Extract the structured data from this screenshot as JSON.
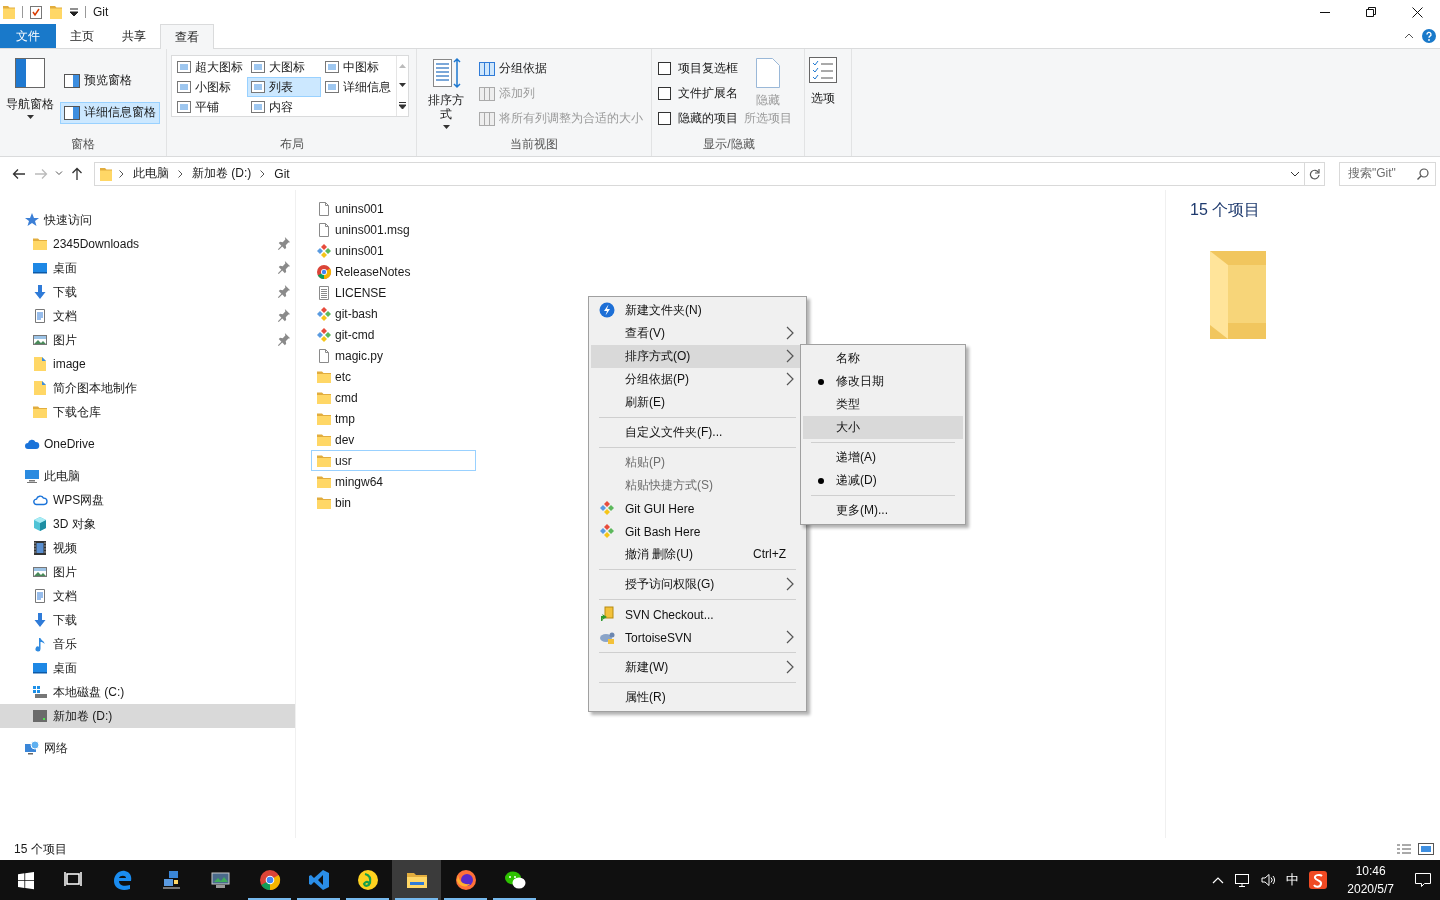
{
  "title_bar": {
    "title": "Git"
  },
  "ribbon": {
    "tabs": [
      {
        "label": "文件",
        "kind": "file-menu",
        "selected": false
      },
      {
        "label": "主页",
        "kind": "tab",
        "selected": false
      },
      {
        "label": "共享",
        "kind": "tab",
        "selected": false
      },
      {
        "label": "查看",
        "kind": "tab",
        "selected": true
      }
    ],
    "panes": {
      "label": "窗格",
      "nav_pane": "导航窗格",
      "preview_pane": {
        "label": "预览窗格",
        "selected": false
      },
      "details_pane": {
        "label": "详细信息窗格",
        "selected": true
      }
    },
    "layout": {
      "label": "布局",
      "options": [
        {
          "label": "超大图标",
          "selected": false
        },
        {
          "label": "大图标",
          "selected": false
        },
        {
          "label": "中图标",
          "selected": false
        },
        {
          "label": "小图标",
          "selected": false
        },
        {
          "label": "列表",
          "selected": true
        },
        {
          "label": "详细信息",
          "selected": false
        },
        {
          "label": "平铺",
          "selected": false
        },
        {
          "label": "内容",
          "selected": false
        }
      ]
    },
    "current_view": {
      "label": "当前视图",
      "sort_by": "排序方式",
      "commands": [
        {
          "label": "分组依据",
          "disabled": false
        },
        {
          "label": "添加列",
          "disabled": true
        },
        {
          "label": "将所有列调整为合适的大小",
          "disabled": true
        }
      ]
    },
    "show_hide": {
      "label": "显示/隐藏",
      "checkboxes": [
        {
          "label": "项目复选框",
          "checked": false
        },
        {
          "label": "文件扩展名",
          "checked": false
        },
        {
          "label": "隐藏的项目",
          "checked": false
        }
      ],
      "hide_selected": {
        "lines": [
          "隐藏",
          "所选项目"
        ],
        "disabled": true
      }
    },
    "options": {
      "label": "选项"
    }
  },
  "address_bar": {
    "path": [
      "此电脑",
      "新加卷 (D:)",
      "Git"
    ]
  },
  "search": {
    "placeholder": "搜索\"Git\""
  },
  "nav_pane": [
    {
      "label": "快速访问",
      "kind": "star",
      "selected": false,
      "children": [
        {
          "label": "2345Downloads",
          "kind": "folder",
          "pinned": true,
          "selected": false
        },
        {
          "label": "桌面",
          "kind": "desktop",
          "pinned": true,
          "selected": false
        },
        {
          "label": "下载",
          "kind": "download",
          "pinned": true,
          "selected": false
        },
        {
          "label": "文档",
          "kind": "document",
          "pinned": true,
          "selected": false
        },
        {
          "label": "图片",
          "kind": "pictures",
          "pinned": true,
          "selected": false
        },
        {
          "label": "image",
          "kind": "folder-doc",
          "pinned": false,
          "selected": false
        },
        {
          "label": "简介图本地制作",
          "kind": "folder-doc",
          "pinned": false,
          "selected": false
        },
        {
          "label": "下载仓库",
          "kind": "folder",
          "pinned": false,
          "selected": false
        }
      ]
    },
    {
      "label": "OneDrive",
      "kind": "onedrive",
      "selected": false
    },
    {
      "label": "此电脑",
      "kind": "pc",
      "selected": false,
      "children": [
        {
          "label": "WPS网盘",
          "kind": "cloud",
          "pinned": false,
          "selected": false
        },
        {
          "label": "3D 对象",
          "kind": "cube",
          "pinned": false,
          "selected": false
        },
        {
          "label": "视频",
          "kind": "video",
          "pinned": false,
          "selected": false
        },
        {
          "label": "图片",
          "kind": "pictures",
          "pinned": false,
          "selected": false
        },
        {
          "label": "文档",
          "kind": "document",
          "pinned": false,
          "selected": false
        },
        {
          "label": "下载",
          "kind": "download",
          "pinned": false,
          "selected": false
        },
        {
          "label": "音乐",
          "kind": "music",
          "pinned": false,
          "selected": false
        },
        {
          "label": "桌面",
          "kind": "desktop",
          "pinned": false,
          "selected": false
        },
        {
          "label": "本地磁盘 (C:)",
          "kind": "drive-c",
          "pinned": false,
          "selected": false
        },
        {
          "label": "新加卷 (D:)",
          "kind": "drive",
          "pinned": false,
          "selected": true
        }
      ]
    },
    {
      "label": "网络",
      "kind": "network",
      "selected": false
    }
  ],
  "files": [
    {
      "name": "unins001",
      "kind": "file",
      "focused": false
    },
    {
      "name": "unins001.msg",
      "kind": "file",
      "focused": false
    },
    {
      "name": "unins001",
      "kind": "git",
      "focused": false
    },
    {
      "name": "ReleaseNotes",
      "kind": "chrome",
      "focused": false
    },
    {
      "name": "LICENSE",
      "kind": "textdoc",
      "focused": false
    },
    {
      "name": "git-bash",
      "kind": "git",
      "focused": false
    },
    {
      "name": "git-cmd",
      "kind": "git",
      "focused": false
    },
    {
      "name": "magic.py",
      "kind": "file",
      "focused": false
    },
    {
      "name": "etc",
      "kind": "folder",
      "focused": false
    },
    {
      "name": "cmd",
      "kind": "folder",
      "focused": false
    },
    {
      "name": "tmp",
      "kind": "folder",
      "focused": false
    },
    {
      "name": "dev",
      "kind": "folder",
      "focused": false
    },
    {
      "name": "usr",
      "kind": "folder",
      "focused": true
    },
    {
      "name": "mingw64",
      "kind": "folder",
      "focused": false
    },
    {
      "name": "bin",
      "kind": "folder",
      "focused": false
    }
  ],
  "details_pane": {
    "count": "15 个项目"
  },
  "context_menu": {
    "items": [
      {
        "kind": "new-folder",
        "label": "新建文件夹(N)",
        "arrow": false,
        "disabled": false,
        "selected": false
      },
      {
        "kind": "plain",
        "label": "查看(V)",
        "arrow": true,
        "disabled": false,
        "selected": false
      },
      {
        "kind": "plain",
        "label": "排序方式(O)",
        "arrow": true,
        "disabled": false,
        "selected": true
      },
      {
        "kind": "plain",
        "label": "分组依据(P)",
        "arrow": true,
        "disabled": false,
        "selected": false
      },
      {
        "kind": "plain",
        "label": "刷新(E)",
        "arrow": false,
        "disabled": false,
        "selected": false
      },
      {
        "kind": "separator"
      },
      {
        "kind": "plain",
        "label": "自定义文件夹(F)...",
        "arrow": false,
        "disabled": false,
        "selected": false
      },
      {
        "kind": "separator"
      },
      {
        "kind": "plain",
        "label": "粘贴(P)",
        "arrow": false,
        "disabled": true,
        "selected": false
      },
      {
        "kind": "plain",
        "label": "粘贴快捷方式(S)",
        "arrow": false,
        "disabled": true,
        "selected": false
      },
      {
        "kind": "git",
        "label": "Git GUI Here",
        "arrow": false,
        "disabled": false,
        "selected": false
      },
      {
        "kind": "git",
        "label": "Git Bash Here",
        "arrow": false,
        "disabled": false,
        "selected": false
      },
      {
        "kind": "plain",
        "label": "撤消 删除(U)",
        "shortcut": "Ctrl+Z",
        "arrow": false,
        "disabled": false,
        "selected": false
      },
      {
        "kind": "separator"
      },
      {
        "kind": "plain",
        "label": "授予访问权限(G)",
        "arrow": true,
        "disabled": false,
        "selected": false
      },
      {
        "kind": "separator"
      },
      {
        "kind": "svn-checkout",
        "label": "SVN Checkout...",
        "arrow": false,
        "disabled": false,
        "selected": false
      },
      {
        "kind": "tortoise",
        "label": "TortoiseSVN",
        "arrow": true,
        "disabled": false,
        "selected": false
      },
      {
        "kind": "separator"
      },
      {
        "kind": "plain",
        "label": "新建(W)",
        "arrow": true,
        "disabled": false,
        "selected": false
      },
      {
        "kind": "separator"
      },
      {
        "kind": "plain",
        "label": "属性(R)",
        "arrow": false,
        "disabled": false,
        "selected": false
      }
    ]
  },
  "sort_submenu": {
    "items": [
      {
        "kind": "item",
        "label": "名称",
        "checked": false,
        "selected": false
      },
      {
        "kind": "item",
        "label": "修改日期",
        "checked": true,
        "selected": false
      },
      {
        "kind": "item",
        "label": "类型",
        "checked": false,
        "selected": false
      },
      {
        "kind": "item",
        "label": "大小",
        "checked": false,
        "selected": true
      },
      {
        "kind": "separator"
      },
      {
        "kind": "item",
        "label": "递增(A)",
        "checked": false,
        "selected": false
      },
      {
        "kind": "item",
        "label": "递减(D)",
        "checked": true,
        "selected": false
      },
      {
        "kind": "separator"
      },
      {
        "kind": "item",
        "label": "更多(M)...",
        "checked": false,
        "selected": false
      }
    ]
  },
  "status_bar": {
    "count": "15 个项目"
  },
  "taskbar": {
    "apps": [
      {
        "kind": "start",
        "running": false,
        "selected": false
      },
      {
        "kind": "task-view",
        "running": false,
        "selected": false
      },
      {
        "kind": "edge",
        "running": false,
        "selected": false
      },
      {
        "kind": "network-app",
        "running": false,
        "selected": false
      },
      {
        "kind": "pc-app",
        "running": false,
        "selected": false
      },
      {
        "kind": "chrome",
        "running": true,
        "selected": false
      },
      {
        "kind": "vscode",
        "running": true,
        "selected": false
      },
      {
        "kind": "music",
        "running": true,
        "selected": false
      },
      {
        "kind": "explorer",
        "running": true,
        "selected": true
      },
      {
        "kind": "firefox",
        "running": true,
        "selected": false
      },
      {
        "kind": "wechat",
        "running": true,
        "selected": false
      }
    ],
    "ime": "中",
    "time": "10:46",
    "date": "2020/5/7"
  }
}
